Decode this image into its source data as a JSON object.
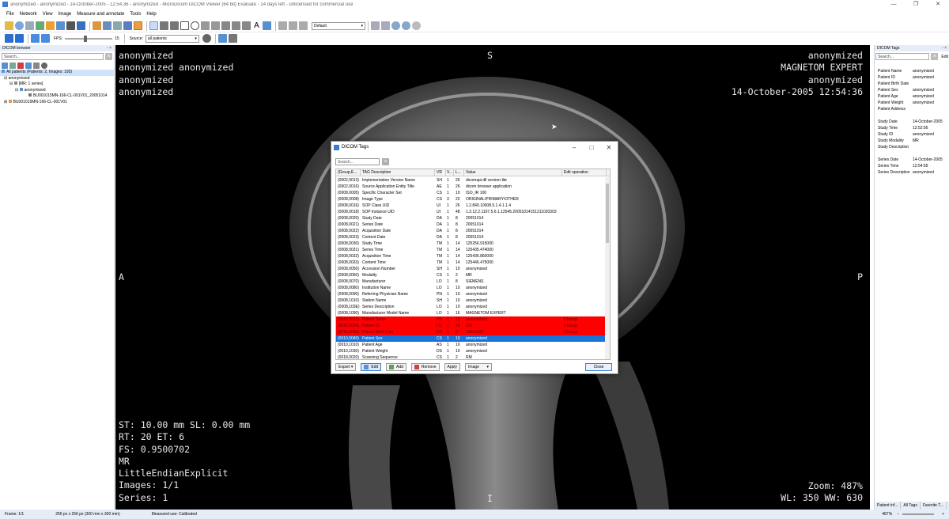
{
  "window": {
    "title": "anonymized - anonymized - 14-October-2005 - 12:54:36 - anonymized - MicroDicom DICOM Viewer (64 bit) Evaluate - 14 days left - unlicensed for commercial use",
    "minimize": "—",
    "maximize": "❐",
    "close": "✕"
  },
  "menu": [
    "File",
    "Network",
    "View",
    "Image",
    "Measure and annotate",
    "Tools",
    "Help"
  ],
  "toolbar": {
    "preset": "Default",
    "fps_label": "FPS:",
    "fps_value": "15",
    "source_label": "Source:",
    "source_value": "all patients"
  },
  "left_panel": {
    "title": "DICOM browser",
    "search_placeholder": "Search...",
    "tree": [
      "All patients (Patients: 2, Images: 193)",
      "anonymized",
      "[MR: 1 series]",
      "anonymized",
      "BU001015MN-166-CL-001V01_20051014",
      "BU001015MN-166-CL-001V01"
    ]
  },
  "overlay": {
    "top_left": [
      "anonymized",
      "anonymized anonymized",
      "anonymized",
      "anonymized"
    ],
    "top_right": [
      "anonymized",
      "MAGNETOM EXPERT",
      "anonymized",
      "14-October-2005 12:54:36"
    ],
    "bottom_left": [
      "ST: 10.00 mm SL: 0.00 mm",
      "RT: 20 ET: 6",
      "FS: 0.9500702",
      "MR",
      "LittleEndianExplicit",
      "Images: 1/1",
      "Series: 1"
    ],
    "bottom_right": [
      "Zoom: 487%",
      "WL: 350 WW: 630"
    ],
    "orient_top": "S",
    "orient_left": "A",
    "orient_right": "P",
    "orient_bottom": "I"
  },
  "right_panel": {
    "title": "DICOM Tags",
    "search_placeholder": "Search...",
    "edit": "Edit",
    "groups": [
      [
        [
          "Patient Name",
          "anonymized"
        ],
        [
          "Patient ID",
          "anonymized"
        ],
        [
          "Patient Birth Date",
          ""
        ],
        [
          "Patient Sex",
          "anonymized"
        ],
        [
          "Patient Age",
          "anonymized"
        ],
        [
          "Patient Weight",
          "anonymized"
        ],
        [
          "Patient Address",
          ""
        ]
      ],
      [
        [
          "Study Date",
          "14-October-2005"
        ],
        [
          "Study Time",
          "12:52:56"
        ],
        [
          "Study ID",
          "anonymized"
        ],
        [
          "Study Modality",
          "MR"
        ],
        [
          "Study Description",
          ""
        ]
      ],
      [
        [
          "Series Date",
          "14-October-2005"
        ],
        [
          "Series Time",
          "12:54:55"
        ],
        [
          "Series Description",
          "anonymized"
        ]
      ]
    ],
    "tabs": [
      "Patient inf...",
      "All Tags",
      "Favorite T..."
    ]
  },
  "status": {
    "frame": "Frame: 1/1",
    "size": "256 px x 256 px (300 mm x 300 mm)",
    "measured": "Measured use: Calibrated",
    "zoom": "487%"
  },
  "dialog": {
    "title": "DICOM Tags",
    "search_placeholder": "Search...",
    "headers": [
      "(Group,E...",
      "TAG Description",
      "VR",
      "V...",
      "L...",
      "Value",
      "Edit operation"
    ],
    "rows": [
      [
        "(0002,0013)",
        "Implementation Version Name",
        "SH",
        "1",
        "26",
        "dicomapi.dll version-lite",
        "",
        ""
      ],
      [
        "(0002,0016)",
        "Source Application Entity Title",
        "AE",
        "1",
        "26",
        "dicom browser application",
        "",
        ""
      ],
      [
        "(0008,0005)",
        "Specific Character Set",
        "CS",
        "1",
        "10",
        "ISO_IR 100",
        "",
        ""
      ],
      [
        "(0008,0008)",
        "Image Type",
        "CS",
        "3",
        "22",
        "ORIGINAL\\PRIMARY\\OTHER",
        "",
        ""
      ],
      [
        "(0008,0016)",
        "SOP Class UID",
        "UI",
        "1",
        "26",
        "1.2.840.10008.5.1.4.1.1.4",
        "",
        ""
      ],
      [
        "(0008,0018)",
        "SOP Instance UID",
        "UI",
        "1",
        "48",
        "1.3.12.2.1107.5.6.1.12545.20051014151211020303",
        "",
        ""
      ],
      [
        "(0008,0020)",
        "Study Date",
        "DA",
        "1",
        "8",
        "20051014",
        "",
        ""
      ],
      [
        "(0008,0021)",
        "Series Date",
        "DA",
        "1",
        "8",
        "20051014",
        "",
        ""
      ],
      [
        "(0008,0022)",
        "Acquisition Date",
        "DA",
        "1",
        "8",
        "20051014",
        "",
        ""
      ],
      [
        "(0008,0023)",
        "Content Date",
        "DA",
        "1",
        "8",
        "20051014",
        "",
        ""
      ],
      [
        "(0008,0030)",
        "Study Time",
        "TM",
        "1",
        "14",
        "125256.915000",
        "",
        ""
      ],
      [
        "(0008,0031)",
        "Series Time",
        "TM",
        "1",
        "14",
        "125435.474000",
        "",
        ""
      ],
      [
        "(0008,0032)",
        "Acquisition Time",
        "TM",
        "1",
        "14",
        "125436.860000",
        "",
        ""
      ],
      [
        "(0008,0033)",
        "Content Time",
        "TM",
        "1",
        "14",
        "125446.475000",
        "",
        ""
      ],
      [
        "(0008,0050)",
        "Accession Number",
        "SH",
        "1",
        "10",
        "anonymized",
        "",
        ""
      ],
      [
        "(0008,0060)",
        "Modality",
        "CS",
        "1",
        "2",
        "MR",
        "",
        ""
      ],
      [
        "(0008,0070)",
        "Manufacturer",
        "LO",
        "1",
        "8",
        "SIEMENS",
        "",
        ""
      ],
      [
        "(0008,0080)",
        "Institution Name",
        "LO",
        "1",
        "10",
        "anonymized",
        "",
        ""
      ],
      [
        "(0008,0090)",
        "Referring Physician Name",
        "PN",
        "1",
        "10",
        "anonymized",
        "",
        ""
      ],
      [
        "(0008,1010)",
        "Station Name",
        "SH",
        "1",
        "10",
        "anonymized",
        "",
        ""
      ],
      [
        "(0008,103E)",
        "Series Description",
        "LO",
        "1",
        "10",
        "anonymized",
        "",
        ""
      ],
      [
        "(0008,1090)",
        "Manufacturer Model Name",
        "LO",
        "1",
        "16",
        "MAGNETOM EXPERT",
        "",
        ""
      ],
      [
        "(0010,0010)",
        "Patient Name",
        "PN",
        "1",
        "10",
        "anonymized",
        "Change",
        "red"
      ],
      [
        "(0010,0020)",
        "Patient ID",
        "LO",
        "1",
        "10",
        "123",
        "Change",
        "red"
      ],
      [
        "(0010,0030)",
        "Patient Birth Date",
        "DA",
        "1",
        "8",
        "19900000",
        "Change",
        "red"
      ],
      [
        "(0010,0040)",
        "Patient Sex",
        "CS",
        "1",
        "10",
        "anonymized",
        "",
        "blue"
      ],
      [
        "(0010,1010)",
        "Patient Age",
        "AS",
        "1",
        "10",
        "anonymized",
        "",
        ""
      ],
      [
        "(0010,1030)",
        "Patient Weight",
        "DS",
        "1",
        "10",
        "anonymized",
        "",
        ""
      ],
      [
        "(0018,0020)",
        "Scanning Sequence",
        "CS",
        "1",
        "2",
        "RM",
        "",
        ""
      ]
    ],
    "buttons": {
      "export": "Export",
      "edit": "Edit",
      "add": "Add",
      "remove": "Remove",
      "apply": "Apply",
      "scope": "Image",
      "close": "Close"
    }
  }
}
